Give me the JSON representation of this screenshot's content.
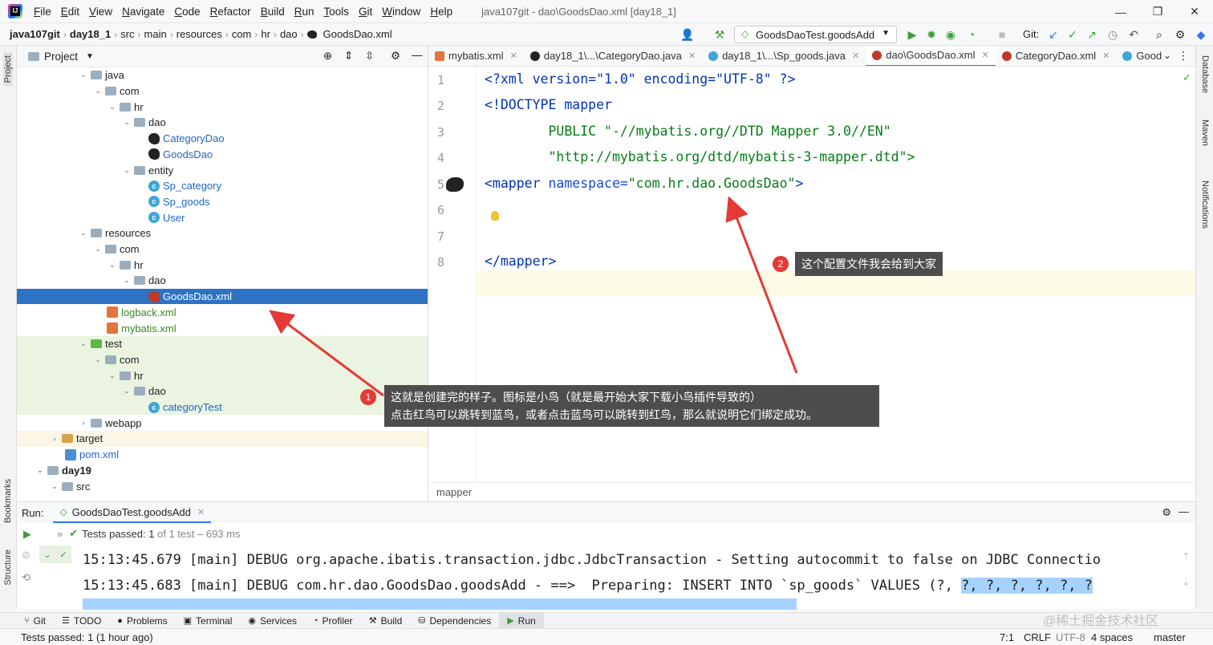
{
  "menubar": {
    "items": [
      "File",
      "Edit",
      "View",
      "Navigate",
      "Code",
      "Refactor",
      "Build",
      "Run",
      "Tools",
      "Git",
      "Window",
      "Help"
    ],
    "title": "java107git - dao\\GoodsDao.xml [day18_1]"
  },
  "navbar": {
    "crumbs": [
      "java107git",
      "day18_1",
      "src",
      "main",
      "resources",
      "com",
      "hr",
      "dao",
      "GoodsDao.xml"
    ],
    "run_config": "GoodsDaoTest.goodsAdd",
    "git_label": "Git:"
  },
  "sidebar_left": {
    "project": "Project",
    "bookmarks": "Bookmarks",
    "structure": "Structure"
  },
  "sidebar_right": {
    "database": "Database",
    "maven": "Maven",
    "notifications": "Notifications"
  },
  "project": {
    "title": "Project",
    "tree": [
      "java",
      "com",
      "hr",
      "dao",
      "CategoryDao",
      "GoodsDao",
      "entity",
      "Sp_category",
      "Sp_goods",
      "User",
      "resources",
      "com",
      "hr",
      "dao",
      "GoodsDao.xml",
      "logback.xml",
      "mybatis.xml",
      "test",
      "com",
      "hr",
      "dao",
      "categoryTest",
      "webapp",
      "target",
      "pom.xml",
      "day19",
      "src"
    ]
  },
  "editor": {
    "tabs": [
      "mybatis.xml",
      "day18_1\\...\\CategoryDao.java",
      "day18_1\\...\\Sp_goods.java",
      "dao\\GoodsDao.xml",
      "CategoryDao.xml",
      "Good"
    ],
    "line_numbers": [
      "1",
      "2",
      "3",
      "4",
      "5",
      "6",
      "7",
      "8"
    ],
    "lines": [
      [
        "<?xml version=\"1.0\" encoding=\"UTF-8\" ?>"
      ],
      [
        "<!DOCTYPE mapper"
      ],
      [
        "        PUBLIC \"-//mybatis.org//DTD Mapper 3.0//EN\""
      ],
      [
        "        \"http://mybatis.org/dtd/mybatis-3-mapper.dtd\">"
      ],
      [
        "<mapper ",
        "namespace=",
        "\"com.hr.dao.GoodsDao\"",
        ">"
      ],
      [
        ""
      ],
      [
        ""
      ],
      [
        "</mapper>"
      ]
    ],
    "footer": "mapper"
  },
  "run": {
    "label": "Run:",
    "tab": "GoodsDaoTest.goodsAdd",
    "tests_passed": "Tests passed:",
    "tests_count": "1",
    "tests_detail": "of 1 test – 693 ms",
    "console": [
      "15:13:45.679 [main] DEBUG org.apache.ibatis.transaction.jdbc.JdbcTransaction - Setting autocommit to false on JDBC Connectio",
      "15:13:45.683 [main] DEBUG com.hr.dao.GoodsDao.goodsAdd - ==>  Preparing: INSERT INTO `sp_goods` VALUES (?, ",
      "?, ?, ?, ?, ?, ?"
    ]
  },
  "bottom_tabs": [
    "Git",
    "TODO",
    "Problems",
    "Terminal",
    "Services",
    "Profiler",
    "Build",
    "Dependencies",
    "Run"
  ],
  "status": {
    "left": "Tests passed: 1 (1 hour ago)",
    "position": "7:1",
    "line_sep": "CRLF",
    "encoding": "UTF-8",
    "indent": "4 spaces",
    "branch": "master"
  },
  "annotations": {
    "one": {
      "num": "1",
      "line1": "这就是创建完的样子。图标是小鸟（就是最开始大家下载小鸟插件导致的）",
      "line2": "点击红鸟可以跳转到蓝鸟，或者点击蓝鸟可以跳转到红鸟，那么就说明它们绑定成功。"
    },
    "two": {
      "num": "2",
      "text": "这个配置文件我会给到大家"
    }
  },
  "watermark": "@稀土掘金技术社区",
  "colors": {
    "accent": "#2e72c4",
    "tag": "#0033b3",
    "string": "#067d17",
    "callout": "#4d4d4d",
    "marker": "#e53935"
  }
}
